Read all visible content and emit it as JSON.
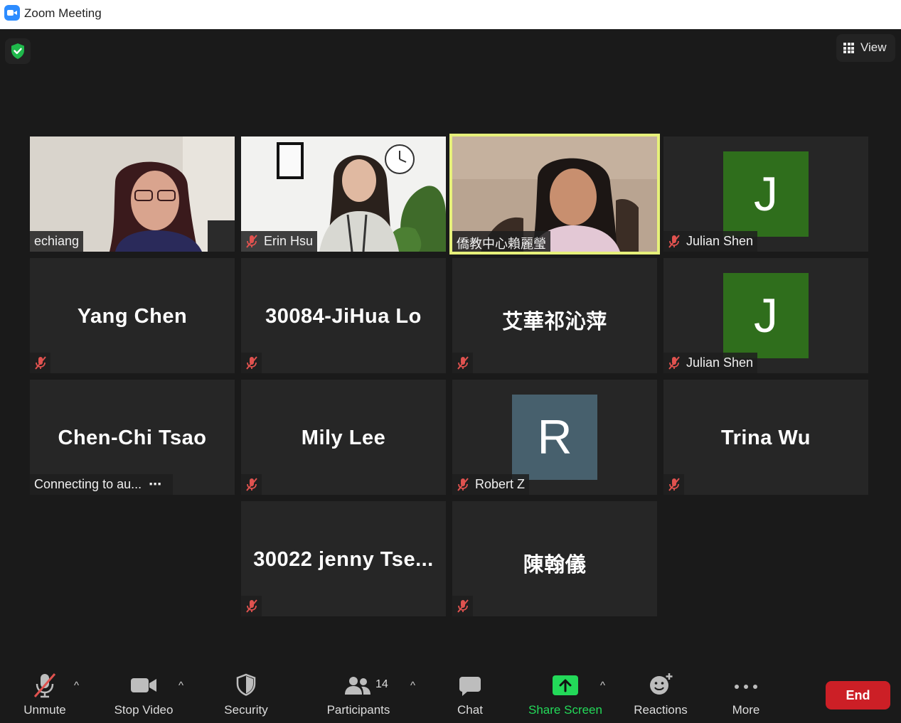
{
  "window": {
    "title": "Zoom Meeting"
  },
  "top": {
    "view_label": "View",
    "security_icon": "shield-check-icon"
  },
  "tiles": {
    "echiang": {
      "name": "echiang"
    },
    "erin": {
      "name": "Erin Hsu"
    },
    "active": {
      "name": "僑教中心賴麗瑩"
    },
    "julian1": {
      "name": "Julian Shen",
      "avatar": "J",
      "avatar_color": "#2f6e1c"
    },
    "yang": {
      "name": "Yang Chen"
    },
    "jihua": {
      "name": "30084-JiHua Lo"
    },
    "ai": {
      "name": "艾華祁沁萍"
    },
    "julian2": {
      "name": "Julian Shen",
      "avatar": "J",
      "avatar_color": "#2f6e1c"
    },
    "tsao": {
      "name": "Chen-Chi Tsao",
      "status": "Connecting to au...",
      "status_dots": "⋯"
    },
    "mily": {
      "name": "Mily Lee"
    },
    "robert": {
      "name": "Robert Z",
      "avatar": "R",
      "avatar_color": "#47606d"
    },
    "trina": {
      "name": "Trina Wu"
    },
    "jenny": {
      "name": "30022 jenny Tse..."
    },
    "chen": {
      "name": "陳翰儀"
    }
  },
  "toolbar": {
    "unmute": "Unmute",
    "stop_video": "Stop Video",
    "security": "Security",
    "participants": "Participants",
    "participants_count": "14",
    "chat": "Chat",
    "share_screen": "Share Screen",
    "reactions": "Reactions",
    "more": "More",
    "end": "End",
    "caret": "^"
  },
  "colors": {
    "share_green": "#23d959",
    "end_red": "#cc1f26",
    "active_border": "#e6f07a",
    "muted_red": "#e0524f"
  }
}
